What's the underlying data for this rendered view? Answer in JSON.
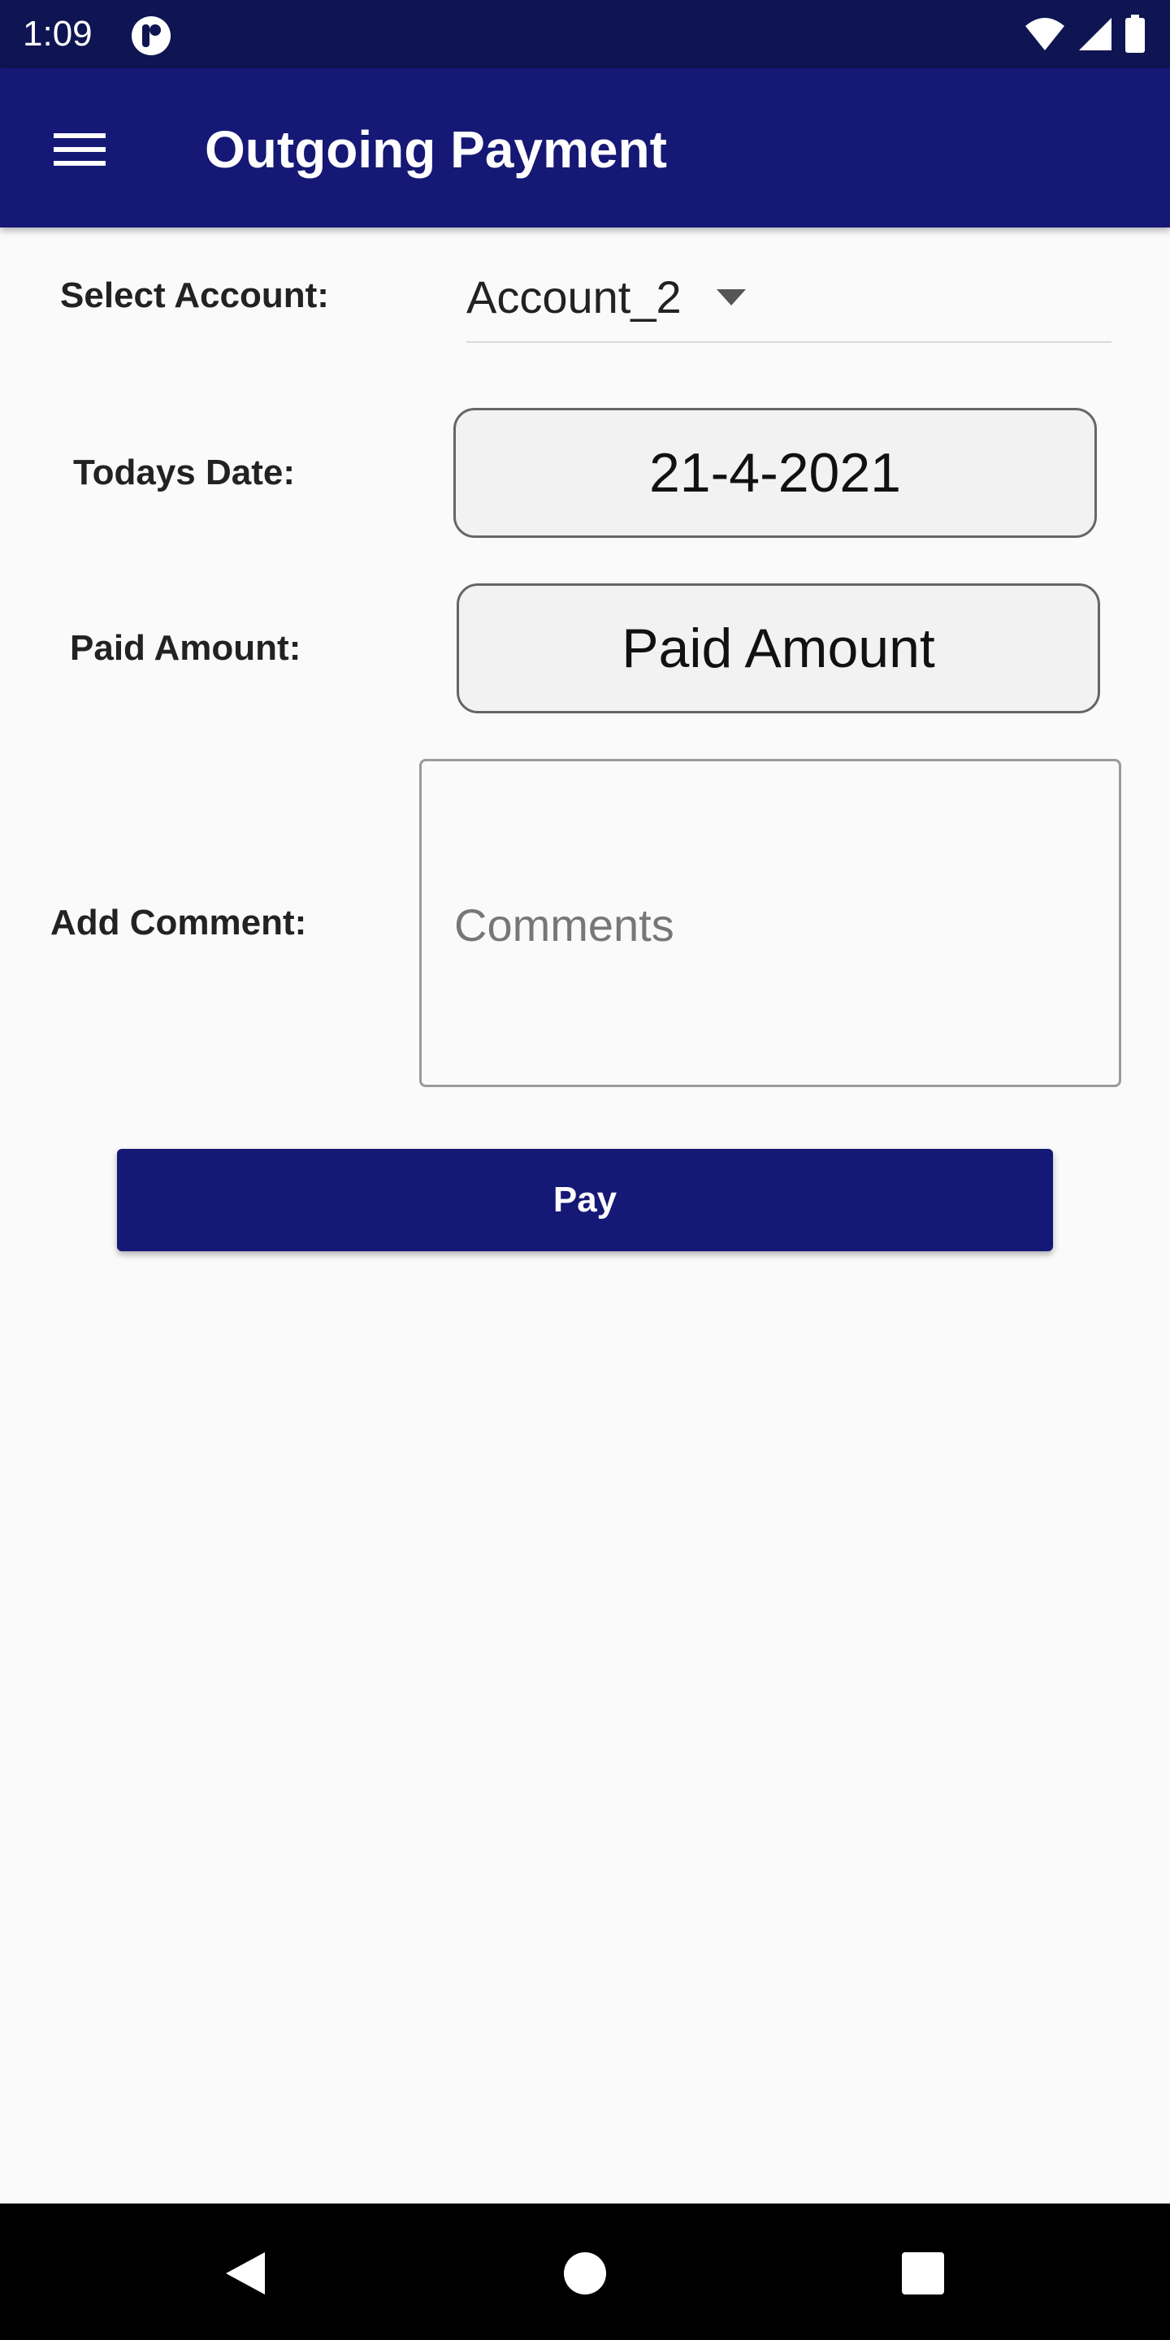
{
  "status_bar": {
    "time": "1:09",
    "app_icon": "notification-app-icon",
    "icons": [
      "wifi-icon",
      "cell-signal-icon",
      "battery-icon"
    ]
  },
  "app_bar": {
    "title": "Outgoing Payment",
    "menu_icon": "hamburger-menu-icon",
    "background_color": "#151875"
  },
  "form": {
    "select_account": {
      "label": "Select Account:",
      "value": "Account_2"
    },
    "todays_date": {
      "label": "Todays Date:",
      "value": "21-4-2021"
    },
    "paid_amount": {
      "label": "Paid Amount:",
      "placeholder": "Paid Amount"
    },
    "add_comment": {
      "label": "Add Comment:",
      "placeholder": "Comments"
    },
    "pay_button": {
      "label": "Pay",
      "color": "#151875"
    }
  },
  "nav_bar": {
    "icons": [
      "back-icon",
      "home-icon",
      "recents-icon"
    ]
  }
}
